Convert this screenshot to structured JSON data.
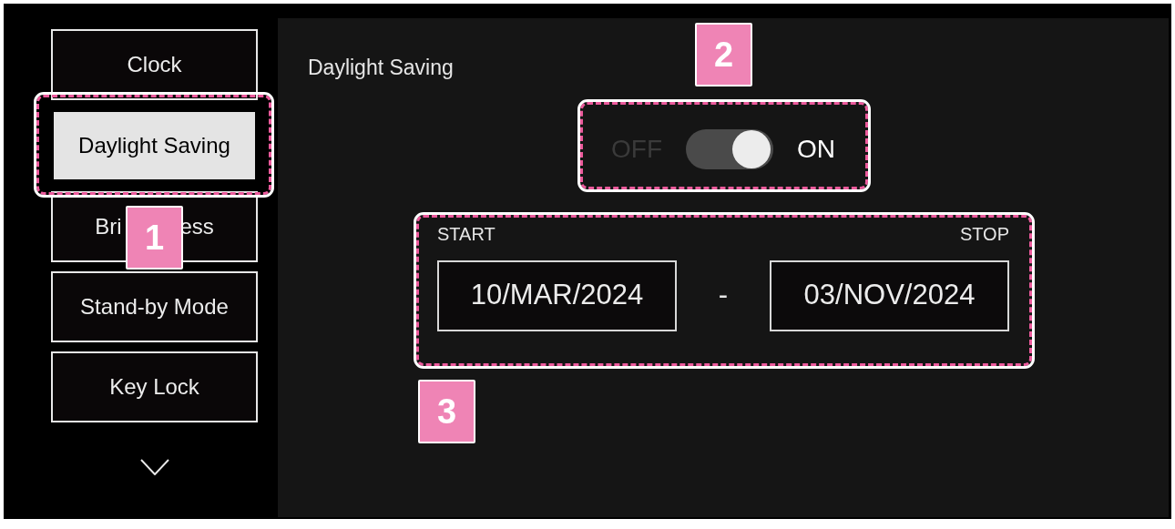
{
  "sidebar": {
    "items": [
      {
        "label": "Clock",
        "selected": false
      },
      {
        "label": "Daylight Saving",
        "selected": true
      },
      {
        "label_parts": [
          "Bri",
          "ess"
        ],
        "selected": false
      },
      {
        "label": "Stand-by Mode",
        "selected": false
      },
      {
        "label": "Key Lock",
        "selected": false
      }
    ]
  },
  "panel": {
    "title": "Daylight Saving",
    "toggle": {
      "off_label": "OFF",
      "on_label": "ON",
      "on": true
    },
    "period": {
      "start_label": "START",
      "stop_label": "STOP",
      "start": "10/MAR/2024",
      "separator": "-",
      "stop": "03/NOV/2024"
    }
  },
  "callouts": [
    {
      "number": "1"
    },
    {
      "number": "2"
    },
    {
      "number": "3"
    }
  ]
}
